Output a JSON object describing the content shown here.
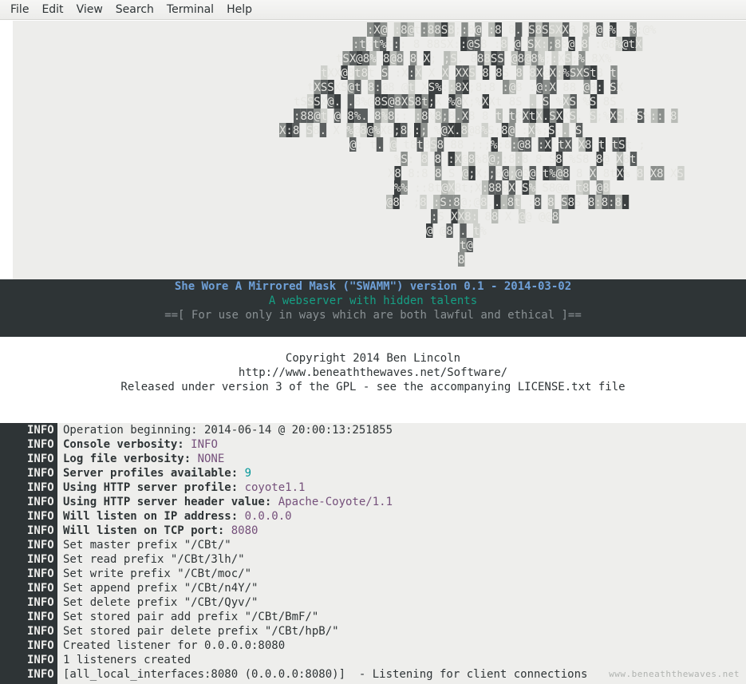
{
  "menubar": {
    "items": [
      "File",
      "Edit",
      "View",
      "Search",
      "Terminal",
      "Help"
    ]
  },
  "ascii_art": {
    "rows": [
      ":X@ :8@t:88S8;:8@ :8 8. S8SSXX@ 8@@ %  %:@%",
      ":t@t%t:: 8 88SX::@S8 :8 @ SX:;88@ 8 :@8%@tX",
      "tSX@8% 8@8 8 X; ;S. 888SS @8@8%;:XS;% 8X%",
      "tXX@8t8t S :X:X X X XXS 8 8S 8 8X@X:%SXSt8 t",
      "tXSSXS@t 8:@8 @t XS%::8X;8;8 :@8 :@:X 88 @8: SX",
      "tSSSX@. .8%@8S@8XS8t;X %@X;%XXt 8S . S %XS %S 8S",
      ":88@t @ 8%. 8%8;: :8%8;8.X8 8 t t@XtX.SXXS. S;%XS.SS%:: 8",
      "X:8 S8. X %@8@%X8;8;:; %@X.8@8%S;8@ :X%;S;. S",
      "@: t. @ t8t8S8 88 ;:;%:8:@8 :X tX X8 t tSt ;",
      "%S: 8 8 :X@8%8@;:8:8 8 S8 %S8 8@ X8t",
      "X8 8:8 8 S @;X;;8@;@8@ t%@8 8 X 8tX% 8 X8 XS",
      "%% ::8t@X8t;X:888X S% S8@@ t8 @8",
      "@8: ;8 :S:8@;@8...8t :8 8 S8S 8:8:8.",
      ":S XX8: 88 X @@ @@8",
      "@ @8 . t%",
      "t@",
      "8"
    ]
  },
  "banner": {
    "title": "She Wore A Mirrored Mask (\"SWAMM\") version 0.1 - 2014-03-02",
    "subtitle": "A webserver with hidden talents",
    "notice": "==[ For use only in ways which are both lawful and ethical ]=="
  },
  "copyright": {
    "line1": "Copyright 2014 Ben Lincoln",
    "line2": "http://www.beneaththewaves.net/Software/",
    "line3": "Released under version 3 of the GPL - see the accompanying LICENSE.txt file"
  },
  "log": {
    "lines": [
      {
        "level": "INFO",
        "label": "Operation beginning: 2014-06-14 @ 20:00:13:251855",
        "bold": false,
        "value": "",
        "value_color": ""
      },
      {
        "level": "INFO",
        "label": "Console verbosity: ",
        "bold": true,
        "value": "INFO",
        "value_color": "purple"
      },
      {
        "level": "INFO",
        "label": "Log file verbosity: ",
        "bold": true,
        "value": "NONE",
        "value_color": "purple"
      },
      {
        "level": "INFO",
        "label": "Server profiles available: ",
        "bold": true,
        "value": "9",
        "value_color": "teal"
      },
      {
        "level": "INFO",
        "label": "Using HTTP server profile: ",
        "bold": true,
        "value": "coyote1.1",
        "value_color": "purple"
      },
      {
        "level": "INFO",
        "label": "Using HTTP server header value: ",
        "bold": true,
        "value": "Apache-Coyote/1.1",
        "value_color": "purple"
      },
      {
        "level": "INFO",
        "label": "Will listen on IP address: ",
        "bold": true,
        "value": "0.0.0.0",
        "value_color": "purple"
      },
      {
        "level": "INFO",
        "label": "Will listen on TCP port: ",
        "bold": true,
        "value": "8080",
        "value_color": "purple"
      },
      {
        "level": "INFO",
        "label": "Set master prefix \"/CBt/\"",
        "bold": false,
        "value": "",
        "value_color": ""
      },
      {
        "level": "INFO",
        "label": "Set read prefix \"/CBt/3lh/\"",
        "bold": false,
        "value": "",
        "value_color": ""
      },
      {
        "level": "INFO",
        "label": "Set write prefix \"/CBt/moc/\"",
        "bold": false,
        "value": "",
        "value_color": ""
      },
      {
        "level": "INFO",
        "label": "Set append prefix \"/CBt/n4Y/\"",
        "bold": false,
        "value": "",
        "value_color": ""
      },
      {
        "level": "INFO",
        "label": "Set delete prefix \"/CBt/Qyv/\"",
        "bold": false,
        "value": "",
        "value_color": ""
      },
      {
        "level": "INFO",
        "label": "Set stored pair add prefix \"/CBt/BmF/\"",
        "bold": false,
        "value": "",
        "value_color": ""
      },
      {
        "level": "INFO",
        "label": "Set stored pair delete prefix \"/CBt/hpB/\"",
        "bold": false,
        "value": "",
        "value_color": ""
      },
      {
        "level": "INFO",
        "label": "Created listener for 0.0.0.0:8080",
        "bold": false,
        "value": "",
        "value_color": ""
      },
      {
        "level": "INFO",
        "label": "1 listeners created",
        "bold": false,
        "value": "",
        "value_color": ""
      },
      {
        "level": "INFO",
        "label": "[all_local_interfaces:8080 (0.0.0.0:8080)]  - Listening for client connections",
        "bold": false,
        "value": "",
        "value_color": ""
      }
    ]
  },
  "watermark": "www.beneaththewaves.net",
  "colors": {
    "terminal_dark": "#2e3436",
    "terminal_light": "#eeeeec",
    "title_blue": "#6fa0d8",
    "subtitle_teal": "#16a085",
    "value_purple": "#75507b",
    "value_teal": "#06989a"
  }
}
